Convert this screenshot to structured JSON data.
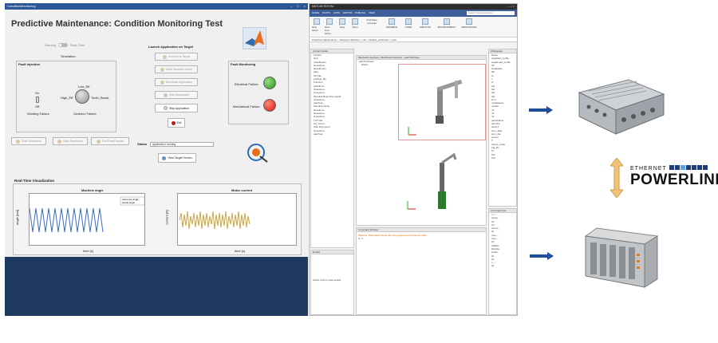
{
  "app": {
    "window_title": "ConditionMonitoring",
    "title": "Predictive Maintenance: Condition Monitoring Test",
    "toggle_left": "Gaming",
    "toggle_right": "Real-Time",
    "simulation_label": "Simulation",
    "launch_panel_title": "Launch Application on Target",
    "launch_buttons": [
      "Connect to Target",
      "Build Simulink Model",
      "Download Application",
      "Start Application"
    ],
    "stop_button": "Stop Application",
    "exit_button": "Exit",
    "fault_injection_title": "Fault Injection",
    "switch_on": "On",
    "switch_off": "Off",
    "winding_failure": "Winding Failure",
    "knob_low": "Low_Eff",
    "knob_high": "High_Eff",
    "knob_tooth": "Tooth_Break",
    "gearbox_failure": "Gearbox Failure",
    "fault_monitoring_title": "Fault Monitoring",
    "electrical_failure": "Electrical Failure",
    "mechanical_failure": "Mechanical Failure",
    "sim_buttons": [
      "Start Simulation",
      "Stop Simulation",
      "Plot Final Results"
    ],
    "status_label": "Status",
    "status_value": "application running",
    "view_target_button": "View Target Screen",
    "realtime_title": "Real-Time Visualization",
    "chart1_title": "Machine angle",
    "chart1_ylabel": "angle [rad]",
    "chart1_xlabel": "time [s]",
    "chart1_legend": [
      "reference angle",
      "actual angle"
    ],
    "chart2_title": "Motor current",
    "chart2_ylabel": "current [A]",
    "chart2_xlabel": "time [s]",
    "x_ticks": [
      "54",
      "55",
      "56",
      "57",
      "58",
      "59",
      "60",
      "61",
      "62",
      "63",
      "64"
    ],
    "chart1_yticks": [
      "2",
      "1",
      "0",
      "-1",
      "-2"
    ],
    "chart2_yticks": [
      "60",
      "40",
      "20",
      "0",
      "-20",
      "-40",
      "-60"
    ]
  },
  "matlab": {
    "window_title": "MATLAB R2019a",
    "tabs": [
      "HOME",
      "PLOTS",
      "APPS",
      "EDITOR",
      "PUBLISH",
      "VIEW"
    ],
    "search_placeholder": "Search Documentation",
    "ribbon": [
      "New Script",
      "New Live Script",
      "New",
      "Open",
      "Find Files",
      "Compare",
      "VARIABLE",
      "CODE",
      "SIMULINK",
      "ENVIRONMENT",
      "RESOURCES"
    ],
    "path": "Predictive Maintenance > Stewpoint Machine > Ufo > Models_truckCase > work",
    "current_folder_title": "Current Folder",
    "folder_items": [
      "Folders",
      "slprj",
      "classifLearn",
      "closedLoo..",
      "classifLearn",
      "data",
      "Slx File",
      "settings_file",
      "Function",
      "classifLoo..",
      "closedLoo..",
      "closedLoo..",
      "Simulink Real-Time Applic",
      "closedLoo..",
      "paleTool..",
      "Simulink cache",
      "classifLoo..",
      "closedLoo..",
      "closedLoo..",
      "TXT File",
      "log_SS.txt",
      "XML Document",
      "closedLoo..",
      "paleTool.."
    ],
    "details_label": "Details",
    "details_text": "Select a file to view details",
    "mech_tabs": [
      "Mechanics Explorer",
      "Mechanics Explorer - paleToolClass"
    ],
    "mech_tree": [
      "paleToolClass",
      "World"
    ],
    "command_window_title": "Command Window",
    "command_warning": "Warning: Redundant blocks are only supported in External mode.",
    "prompt": "fx >>",
    "workspace_title": "Workspace",
    "workspace_items": [
      "Name",
      "angleRef_profile",
      "angleLoad_profile",
      "dP",
      "Deadtable",
      "dfn",
      "dt",
      "f",
      "fs",
      "fa1",
      "fa2",
      "fa3",
      "fa4",
      "lmnt",
      "mydatasets",
      "mySim",
      "n1",
      "n2",
      "n3",
      "panelName",
      "pFlnOlo",
      "sampT",
      "spm_data",
      "spm_dat",
      "sensor",
      "T",
      "torque_array",
      "trig_ldx",
      "Ts",
      "Ts1",
      "Ts2"
    ],
    "history_title": "Command His...",
    "history_items": [
      "x = ...",
      "savep..",
      "dir",
      "clc",
      "remov..",
      "dir",
      "mos -..",
      "mos -..",
      "clc",
      "validat..",
      "Dworkp..",
      "loadd..",
      "dir",
      "clc",
      "x - ..",
      "dir"
    ]
  },
  "hardware": {
    "ethernet_label": "ETHERNET",
    "powerlink_label": "POWERLINK"
  }
}
